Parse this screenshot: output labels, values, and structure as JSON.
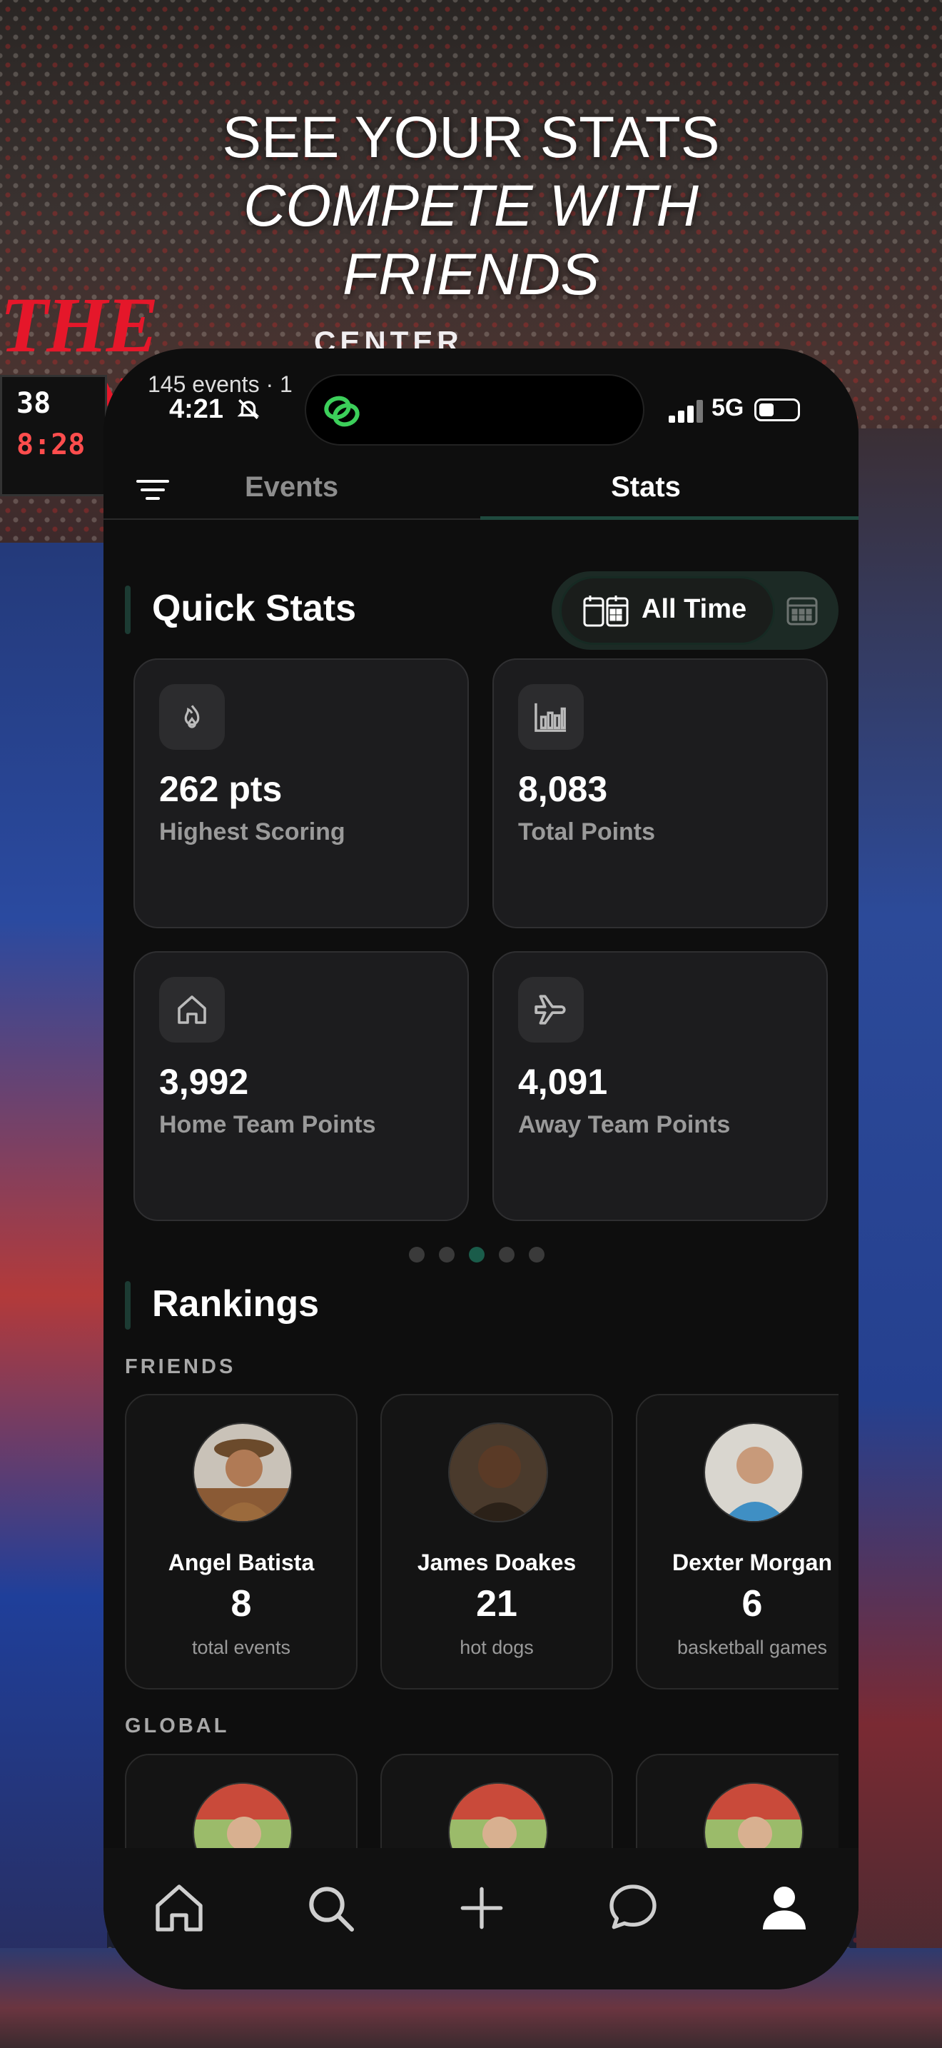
{
  "headline": {
    "line1": "SEE YOUR STATS",
    "line2": "COMPETE WITH",
    "line3": "FRIENDS"
  },
  "background": {
    "sign_text": "THE KING",
    "sign_sub": "CENTER",
    "score_home": "38",
    "score_clock": "8:28"
  },
  "status_bar": {
    "behind_text": "145 events · 1",
    "time": "4:21",
    "network": "5G"
  },
  "tabs": {
    "events": "Events",
    "stats": "Stats",
    "active": "Stats"
  },
  "quick_stats": {
    "title": "Quick Stats",
    "range_label": "All Time",
    "cards": [
      {
        "icon": "flame-icon",
        "value": "262 pts",
        "label": "Highest Scoring"
      },
      {
        "icon": "bar-chart-icon",
        "value": "8,083",
        "label": "Total Points"
      },
      {
        "icon": "home-icon",
        "value": "3,992",
        "label": "Home Team Points"
      },
      {
        "icon": "plane-icon",
        "value": "4,091",
        "label": "Away Team Points"
      }
    ],
    "pagination": {
      "count": 5,
      "active_index": 2
    }
  },
  "rankings": {
    "title": "Rankings",
    "friends_label": "FRIENDS",
    "global_label": "GLOBAL",
    "friends": [
      {
        "name": "Angel Batista",
        "count": "8",
        "unit": "total events"
      },
      {
        "name": "James Doakes",
        "count": "21",
        "unit": "hot dogs"
      },
      {
        "name": "Dexter Morgan",
        "count": "6",
        "unit": "basketball games"
      }
    ]
  },
  "colors": {
    "accent": "#1a5c4a",
    "phone_bg": "#0e0e0e",
    "card_bg": "#1c1c1e",
    "muted_text": "#9a9a9a"
  },
  "nav": [
    "home-icon",
    "search-icon",
    "plus-icon",
    "chat-icon",
    "profile-icon"
  ]
}
